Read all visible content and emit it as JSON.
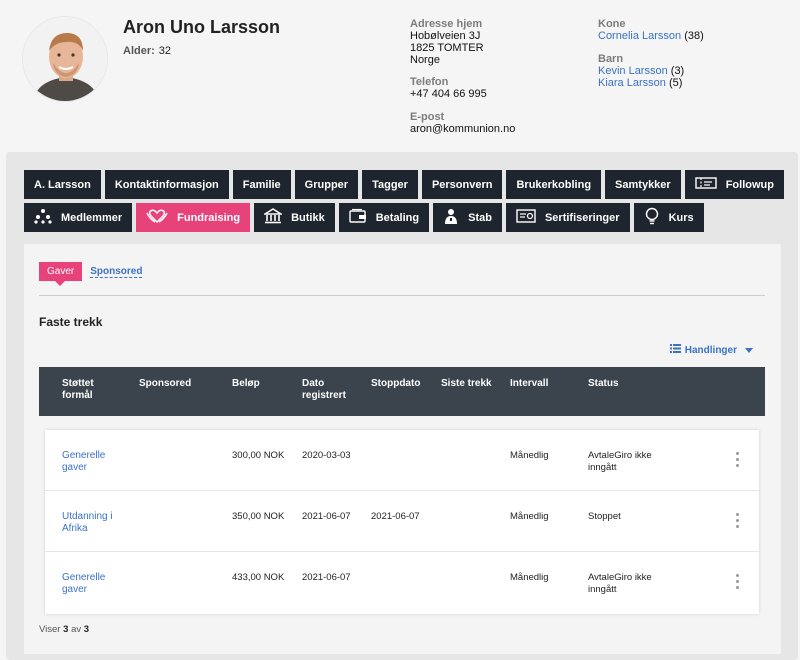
{
  "profile": {
    "name": "Aron Uno Larsson",
    "age_label": "Alder:",
    "age": "32",
    "address_label": "Adresse hjem",
    "address_line1": "Hobølveien 3J",
    "address_line2": "1825 TOMTER",
    "address_line3": "Norge",
    "phone_label": "Telefon",
    "phone": "+47 404 66 995",
    "email_label": "E-post",
    "email": "aron@kommunion.no",
    "spouse_label": "Kone",
    "spouse_name": "Cornelia Larsson",
    "spouse_age": "(38)",
    "children_label": "Barn",
    "children": [
      {
        "name": "Kevin Larsson",
        "age": "(3)"
      },
      {
        "name": "Kiara Larsson",
        "age": "(5)"
      }
    ]
  },
  "tabs_row1": [
    {
      "label": "A. Larsson"
    },
    {
      "label": "Kontaktinformasjon"
    },
    {
      "label": "Familie"
    },
    {
      "label": "Grupper"
    },
    {
      "label": "Tagger"
    },
    {
      "label": "Personvern"
    },
    {
      "label": "Brukerkobling"
    },
    {
      "label": "Samtykker"
    },
    {
      "label": "Followup",
      "icon": "ticket-icon"
    }
  ],
  "tabs_row2": [
    {
      "label": "Medlemmer",
      "icon": "org-chart-icon"
    },
    {
      "label": "Fundraising",
      "icon": "heart-hands-icon",
      "active": true
    },
    {
      "label": "Butikk",
      "icon": "store-icon"
    },
    {
      "label": "Betaling",
      "icon": "wallet-icon"
    },
    {
      "label": "Stab",
      "icon": "person-badge-icon"
    },
    {
      "label": "Sertifiseringer",
      "icon": "certificate-icon"
    },
    {
      "label": "Kurs",
      "icon": "lightbulb-icon"
    }
  ],
  "subtabs": {
    "active": "Gaver",
    "other": "Sponsored"
  },
  "section_title": "Faste trekk",
  "actions_label": "Handlinger",
  "table": {
    "headers": {
      "purpose": "Støttet formål",
      "sponsored": "Sponsored",
      "amount": "Beløp",
      "registered": "Dato registrert",
      "stopdate": "Stoppdato",
      "last": "Siste trekk",
      "interval": "Intervall",
      "status": "Status"
    },
    "rows": [
      {
        "purpose": "Generelle gaver",
        "amount": "300,00 NOK",
        "registered": "2020-03-03",
        "stopdate": "",
        "interval": "Månedlig",
        "status": "AvtaleGiro ikke inngått"
      },
      {
        "purpose": "Utdanning i Afrika",
        "amount": "350,00 NOK",
        "registered": "2021-06-07",
        "stopdate": "2021-06-07",
        "interval": "Månedlig",
        "status": "Stoppet"
      },
      {
        "purpose": "Generelle gaver",
        "amount": "433,00 NOK",
        "registered": "2021-06-07",
        "stopdate": "",
        "interval": "Månedlig",
        "status": "AvtaleGiro ikke inngått"
      }
    ]
  },
  "footer": {
    "prefix": "Viser",
    "shown": "3",
    "of": "av",
    "total": "3"
  },
  "colors": {
    "accent": "#e8427a",
    "tab_dark": "#1f252e",
    "link": "#3a72c4",
    "table_head": "#3b434c"
  }
}
